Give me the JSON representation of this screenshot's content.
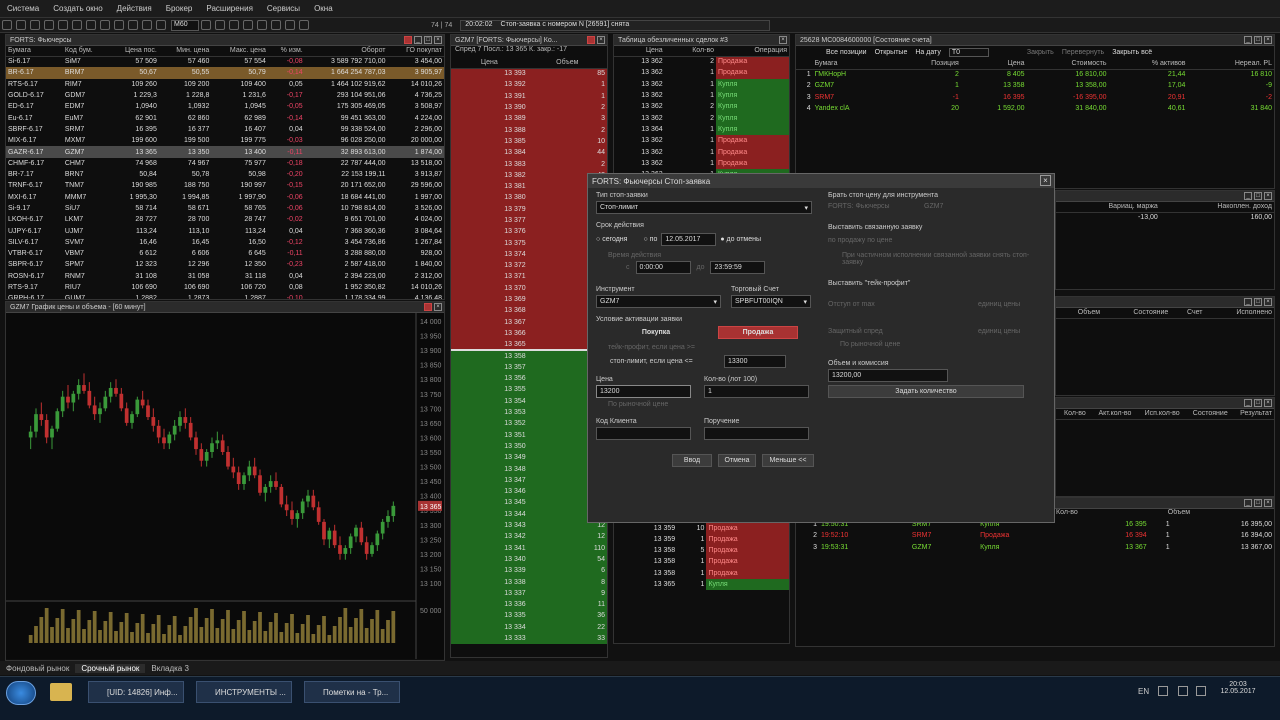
{
  "menu": [
    "Система",
    "Создать окно",
    "Действия",
    "Брокер",
    "Расширения",
    "Сервисы",
    "Окна"
  ],
  "toolbar": {
    "dropdown": "M60",
    "counter": "74 | 74",
    "status_time": "20:02:02",
    "status_text": "Стоп-заявка с номером N [26591] снята"
  },
  "futures_panel": {
    "title": "FORTS: Фьючерсы",
    "headers": [
      "Бумага",
      "Код бум.",
      "Цена пос.",
      "Мин. цена",
      "Макс. цена",
      "% изм.",
      "Оборот",
      "ГО покупат"
    ],
    "rows": [
      [
        "Si-6.17",
        "SiM7",
        "57 509",
        "57 460",
        "57 554",
        "-0,08",
        "3 589 792 710,00",
        "3 454,00"
      ],
      [
        "BR-6.17",
        "BRM7",
        "50,67",
        "50,55",
        "50,79",
        "-0,14",
        "1 664 254 787,03",
        "3 905,97"
      ],
      [
        "RTS-6.17",
        "RIM7",
        "109 260",
        "109 200",
        "109 400",
        "0,05",
        "1 464 102 919,62",
        "14 010,26"
      ],
      [
        "GOLD-6.17",
        "GDM7",
        "1 229,3",
        "1 228,8",
        "1 231,6",
        "-0,17",
        "293 104 951,06",
        "4 736,25"
      ],
      [
        "ED-6.17",
        "EDM7",
        "1,0940",
        "1,0932",
        "1,0945",
        "-0,05",
        "175 305 469,05",
        "3 508,97"
      ],
      [
        "Eu-6.17",
        "EuM7",
        "62 901",
        "62 860",
        "62 989",
        "-0,14",
        "99 451 363,00",
        "4 224,00"
      ],
      [
        "SBRF-6.17",
        "SRM7",
        "16 395",
        "16 377",
        "16 407",
        "0,04",
        "99 338 524,00",
        "2 296,00"
      ],
      [
        "MIX-6.17",
        "MXM7",
        "199 600",
        "199 500",
        "199 775",
        "-0,03",
        "96 028 250,00",
        "20 000,00"
      ],
      [
        "GAZR-6.17",
        "GZM7",
        "13 365",
        "13 350",
        "13 400",
        "-0,11",
        "32 893 613,00",
        "1 874,00"
      ],
      [
        "CHMF-6.17",
        "CHM7",
        "74 968",
        "74 967",
        "75 977",
        "-0,18",
        "22 787 444,00",
        "13 518,00"
      ],
      [
        "BR-7.17",
        "BRN7",
        "50,84",
        "50,78",
        "50,98",
        "-0,20",
        "22 153 199,11",
        "3 913,87"
      ],
      [
        "TRNF-6.17",
        "TNM7",
        "190 985",
        "188 750",
        "190 997",
        "-0,15",
        "20 171 652,00",
        "29 596,00"
      ],
      [
        "MXI-6.17",
        "MMM7",
        "1 995,30",
        "1 994,85",
        "1 997,90",
        "-0,06",
        "18 684 441,00",
        "1 997,00"
      ],
      [
        "Si-9.17",
        "SiU7",
        "58 714",
        "58 671",
        "58 765",
        "-0,06",
        "10 798 814,00",
        "3 526,00"
      ],
      [
        "LKOH-6.17",
        "LKM7",
        "28 727",
        "28 700",
        "28 747",
        "-0,02",
        "9 651 701,00",
        "4 024,00"
      ],
      [
        "UJPY-6.17",
        "UJM7",
        "113,24",
        "113,10",
        "113,24",
        "0,04",
        "7 368 360,36",
        "3 084,64"
      ],
      [
        "SILV-6.17",
        "SVM7",
        "16,46",
        "16,45",
        "16,50",
        "-0,12",
        "3 454 736,86",
        "1 267,84"
      ],
      [
        "VTBR-6.17",
        "VBM7",
        "6 612",
        "6 606",
        "6 645",
        "-0,11",
        "3 288 880,00",
        "928,00"
      ],
      [
        "SBPR-6.17",
        "SPM7",
        "12 323",
        "12 296",
        "12 350",
        "-0,23",
        "2 587 418,00",
        "1 840,00"
      ],
      [
        "ROSN-6.17",
        "RNM7",
        "31 108",
        "31 058",
        "31 118",
        "0,04",
        "2 394 223,00",
        "2 312,00"
      ],
      [
        "RTS-9.17",
        "RIU7",
        "106 690",
        "106 690",
        "106 720",
        "0,08",
        "1 952 350,82",
        "14 010,26"
      ],
      [
        "GRPH-6.17",
        "GUM7",
        "1 2882",
        "1 2873",
        "1 2887",
        "-0,10",
        "1 178 334,99",
        "4 136,48"
      ]
    ]
  },
  "chart_panel": {
    "title": "GZM7 График цены и объема - [60 минут]",
    "price_ticks": [
      "14 000",
      "13 950",
      "13 900",
      "13 850",
      "13 800",
      "13 750",
      "13 700",
      "13 650",
      "13 600",
      "13 550",
      "13 500",
      "13 450",
      "13 400",
      "13 350",
      "13 300",
      "13 250",
      "13 200",
      "13 150",
      "13 100"
    ],
    "last_price": "13 365",
    "volume_tick": "50 000"
  },
  "chart_data": {
    "type": "candlestick",
    "ylim": [
      13100,
      14000
    ],
    "ohlc": [
      [
        13600,
        13640,
        13560,
        13620
      ],
      [
        13620,
        13700,
        13600,
        13680
      ],
      [
        13680,
        13720,
        13640,
        13660
      ],
      [
        13660,
        13680,
        13580,
        13600
      ],
      [
        13600,
        13640,
        13560,
        13630
      ],
      [
        13630,
        13700,
        13620,
        13690
      ],
      [
        13690,
        13760,
        13670,
        13740
      ],
      [
        13740,
        13780,
        13700,
        13720
      ],
      [
        13720,
        13760,
        13690,
        13750
      ],
      [
        13750,
        13800,
        13730,
        13780
      ],
      [
        13780,
        13820,
        13750,
        13760
      ],
      [
        13760,
        13790,
        13700,
        13710
      ],
      [
        13710,
        13740,
        13660,
        13680
      ],
      [
        13680,
        13720,
        13650,
        13700
      ],
      [
        13700,
        13760,
        13690,
        13740
      ],
      [
        13740,
        13790,
        13720,
        13770
      ],
      [
        13770,
        13800,
        13740,
        13750
      ],
      [
        13750,
        13770,
        13690,
        13700
      ],
      [
        13700,
        13720,
        13640,
        13650
      ],
      [
        13650,
        13690,
        13630,
        13680
      ],
      [
        13680,
        13740,
        13670,
        13730
      ],
      [
        13730,
        13760,
        13700,
        13710
      ],
      [
        13710,
        13730,
        13660,
        13670
      ],
      [
        13670,
        13700,
        13620,
        13640
      ],
      [
        13640,
        13660,
        13580,
        13600
      ],
      [
        13600,
        13630,
        13560,
        13580
      ],
      [
        13580,
        13620,
        13560,
        13610
      ],
      [
        13610,
        13660,
        13590,
        13640
      ],
      [
        13640,
        13690,
        13620,
        13670
      ],
      [
        13670,
        13700,
        13630,
        13650
      ],
      [
        13650,
        13670,
        13590,
        13600
      ],
      [
        13600,
        13620,
        13540,
        13560
      ],
      [
        13560,
        13580,
        13500,
        13520
      ],
      [
        13520,
        13560,
        13500,
        13550
      ],
      [
        13550,
        13600,
        13530,
        13580
      ],
      [
        13580,
        13620,
        13560,
        13590
      ],
      [
        13590,
        13610,
        13540,
        13550
      ],
      [
        13550,
        13570,
        13490,
        13500
      ],
      [
        13500,
        13530,
        13460,
        13480
      ],
      [
        13480,
        13500,
        13420,
        13440
      ],
      [
        13440,
        13480,
        13420,
        13470
      ],
      [
        13470,
        13520,
        13450,
        13500
      ],
      [
        13500,
        13530,
        13460,
        13470
      ],
      [
        13470,
        13490,
        13400,
        13410
      ],
      [
        13410,
        13440,
        13380,
        13430
      ],
      [
        13430,
        13470,
        13410,
        13450
      ],
      [
        13450,
        13480,
        13420,
        13430
      ],
      [
        13430,
        13440,
        13360,
        13370
      ],
      [
        13370,
        13400,
        13330,
        13350
      ],
      [
        13350,
        13380,
        13300,
        13320
      ],
      [
        13320,
        13350,
        13290,
        13340
      ],
      [
        13340,
        13390,
        13320,
        13380
      ],
      [
        13380,
        13420,
        13360,
        13400
      ],
      [
        13400,
        13420,
        13350,
        13360
      ],
      [
        13360,
        13380,
        13300,
        13310
      ],
      [
        13310,
        13320,
        13230,
        13250
      ],
      [
        13250,
        13290,
        13220,
        13280
      ],
      [
        13280,
        13300,
        13220,
        13230
      ],
      [
        13230,
        13260,
        13180,
        13200
      ],
      [
        13200,
        13230,
        13180,
        13220
      ],
      [
        13220,
        13270,
        13200,
        13260
      ],
      [
        13260,
        13300,
        13240,
        13290
      ],
      [
        13290,
        13310,
        13230,
        13240
      ],
      [
        13240,
        13260,
        13180,
        13200
      ],
      [
        13200,
        13240,
        13190,
        13230
      ],
      [
        13230,
        13280,
        13210,
        13270
      ],
      [
        13270,
        13320,
        13250,
        13310
      ],
      [
        13310,
        13350,
        13290,
        13330
      ],
      [
        13330,
        13380,
        13310,
        13365
      ]
    ]
  },
  "orderbook": {
    "title": "GZM7 [FORTS: Фьючерсы] Ко...",
    "spread_label": "Спред 7 Посл.: 13 365 К. закр.: -17",
    "headers": [
      "Цена",
      "Объем"
    ],
    "asks": [
      [
        "13 393",
        "85"
      ],
      [
        "13 392",
        "1"
      ],
      [
        "13 391",
        "1"
      ],
      [
        "13 390",
        "2"
      ],
      [
        "13 389",
        "3"
      ],
      [
        "13 388",
        "2"
      ],
      [
        "13 385",
        "10"
      ],
      [
        "13 384",
        "44"
      ],
      [
        "13 383",
        "2"
      ],
      [
        "13 382",
        "43"
      ],
      [
        "13 381",
        "10"
      ],
      [
        "13 380",
        "29"
      ],
      [
        "13 379",
        "16"
      ],
      [
        "13 377",
        "20"
      ],
      [
        "13 376",
        "2"
      ],
      [
        "13 375",
        "3"
      ],
      [
        "13 374",
        "5"
      ],
      [
        "13 372",
        "8"
      ],
      [
        "13 371",
        "3"
      ],
      [
        "13 370",
        "10"
      ],
      [
        "13 369",
        "3"
      ],
      [
        "13 368",
        "5"
      ],
      [
        "13 367",
        "3"
      ],
      [
        "13 366",
        "10"
      ],
      [
        "13 365",
        "2"
      ]
    ],
    "bids": [
      [
        "13 358",
        "4"
      ],
      [
        "13 357",
        "12"
      ],
      [
        "13 356",
        "3"
      ],
      [
        "13 355",
        "2"
      ],
      [
        "13 354",
        "5"
      ],
      [
        "13 353",
        "1"
      ],
      [
        "13 352",
        "38"
      ],
      [
        "13 351",
        "21"
      ],
      [
        "13 350",
        "130"
      ],
      [
        "13 349",
        "20"
      ],
      [
        "13 348",
        "6"
      ],
      [
        "13 347",
        "20"
      ],
      [
        "13 346",
        "14"
      ],
      [
        "13 345",
        "10"
      ],
      [
        "13 344",
        "22"
      ],
      [
        "13 343",
        "12"
      ],
      [
        "13 342",
        "12"
      ],
      [
        "13 341",
        "110"
      ],
      [
        "13 340",
        "54"
      ],
      [
        "13 339",
        "6"
      ],
      [
        "13 338",
        "8"
      ],
      [
        "13 337",
        "9"
      ],
      [
        "13 336",
        "11"
      ],
      [
        "13 335",
        "36"
      ],
      [
        "13 334",
        "22"
      ],
      [
        "13 333",
        "33"
      ]
    ]
  },
  "trades": {
    "title": "Таблица обезличенных сделок #3",
    "headers": [
      "Цена",
      "Кол-во",
      "Операция"
    ],
    "top": [
      [
        "13 362",
        "2",
        "Продажа"
      ],
      [
        "13 362",
        "1",
        "Продажа"
      ],
      [
        "13 362",
        "1",
        "Купля"
      ],
      [
        "13 362",
        "1",
        "Купля"
      ],
      [
        "13 362",
        "2",
        "Купля"
      ],
      [
        "13 362",
        "2",
        "Купля"
      ],
      [
        "13 364",
        "1",
        "Купля"
      ],
      [
        "13 362",
        "1",
        "Продажа"
      ],
      [
        "13 362",
        "1",
        "Продажа"
      ],
      [
        "13 362",
        "1",
        "Продажа"
      ],
      [
        "13 362",
        "1",
        "Купля"
      ]
    ],
    "bottom": [
      [
        "13 362",
        "10",
        "Продажа"
      ],
      [
        "13 360",
        "2",
        "Продажа"
      ],
      [
        "13 360",
        "1",
        "Продажа"
      ],
      [
        "13 360",
        "1",
        "Продажа"
      ],
      [
        "13 359",
        "10",
        "Продажа"
      ],
      [
        "13 359",
        "1",
        "Продажа"
      ],
      [
        "13 358",
        "5",
        "Продажа"
      ],
      [
        "13 358",
        "1",
        "Продажа"
      ],
      [
        "13 358",
        "1",
        "Продажа"
      ],
      [
        "13 365",
        "1",
        "Купля"
      ]
    ]
  },
  "positions": {
    "title": "25628 MC0084600000 [Состояние счета]",
    "filter_all": "Все позиции",
    "filter_open": "Открытые",
    "date_label": "На дату",
    "t0": "T0",
    "close_label": "Закрыть",
    "reverse_label": "Перевернуть",
    "close_all_label": "Закрыть всё",
    "headers": [
      "",
      "Бумага",
      "Позиция",
      "Цена",
      "Стоимость",
      "% активов",
      "Нереал. PL"
    ],
    "rows": [
      [
        "1",
        "ГМКНорН",
        "2",
        "8 405",
        "16 810,00",
        "21,44",
        "16 810"
      ],
      [
        "2",
        "GZM7",
        "1",
        "13 358",
        "13 358,00",
        "17,04",
        "-9"
      ],
      [
        "3",
        "SRM7",
        "-1",
        "16 395",
        "-16 395,00",
        "20,91",
        "-2"
      ],
      [
        "4",
        "Yandex clA",
        "20",
        "1 592,00",
        "31 840,00",
        "40,61",
        "31 840"
      ]
    ]
  },
  "margin": {
    "headers": [
      "Вариац. маржа",
      "Накоплен. доход"
    ],
    "values": [
      "-13,00",
      "160,00"
    ]
  },
  "orders_panel": {
    "headers": [
      "Объем",
      "Состояние",
      "Счет",
      "Исполнено"
    ]
  },
  "stops_panel": {
    "headers": [
      "Кол-во",
      "Акт.кол-во",
      "Исп.кол-во",
      "Состояние",
      "Результат"
    ]
  },
  "deals_panel": {
    "headers": [
      "Кол-во",
      "Объем"
    ],
    "rows": [
      [
        "1",
        "19:50:31",
        "SRM7",
        "Купля",
        "16 395",
        "1",
        "16 395,00"
      ],
      [
        "2",
        "19:52:10",
        "SRM7",
        "Продажа",
        "16 394",
        "1",
        "16 394,00"
      ],
      [
        "3",
        "19:53:31",
        "GZM7",
        "Купля",
        "13 367",
        "1",
        "13 367,00"
      ]
    ]
  },
  "dialog": {
    "title": "FORTS: Фьючерсы Стоп-заявка",
    "type_label": "Тип стоп-заявки",
    "type_value": "Стоп-лимит",
    "term_label": "Срок действия",
    "today": "сегодня",
    "until": "по",
    "until_date": "12.05.2017",
    "until_cancel": "до отмены",
    "time_label": "Время действия",
    "time_from": "c",
    "time_from_val": "0:00:00",
    "time_to": "до",
    "time_to_val": "23:59:59",
    "instrument_label": "Инструмент",
    "instrument_value": "GZM7",
    "account_label": "Торговый Счет",
    "account_value": "SPBFUT00IQN",
    "condition_label": "Условие активации заявки",
    "buy": "Покупка",
    "sell": "Продажа",
    "take_profit_line": "тейк-профит, если цена >=",
    "stop_limit_line": "стоп-лимит, если цена <=",
    "stop_price": "13300",
    "price_label": "Цена",
    "price_value": "13200",
    "qty_label": "Кол-во (лот 100)",
    "qty_value": "1",
    "market_price": "По рыночной цене",
    "client_label": "Код Клиента",
    "commission_label": "Поручение",
    "ok": "Ввод",
    "cancel": "Отмена",
    "less": "Меньше <<",
    "right_instr_label": "Брать стоп-цену для инструмента",
    "right_market": "FORTS: Фьючерсы",
    "right_code": "GZM7",
    "linked_label": "Выставить связанную заявку",
    "linked_price": "по продажу по цене",
    "linked_partial": "При частичном исполнении связанной заявки снять стоп-заявку",
    "tp_label": "Выставить \"тейк-профит\"",
    "tp_offset": "Отступ от max",
    "tp_units": "единиц цены",
    "tp_spread": "Защитный спред",
    "tp_market": "По рыночной цене",
    "volume_label": "Объем и комиссия",
    "volume_value": "13200,00",
    "set_qty": "Задать количество"
  },
  "bottom_tabs": [
    "Фондовый рынок",
    "Срочный рынок",
    "Вкладка 3"
  ],
  "taskbar": {
    "items": [
      "[UID: 14826] Инф...",
      "ИНСТРУМЕНТЫ ...",
      "Пометки на - Тр..."
    ],
    "lang": "EN",
    "time": "20:03",
    "date": "12.05.2017"
  }
}
